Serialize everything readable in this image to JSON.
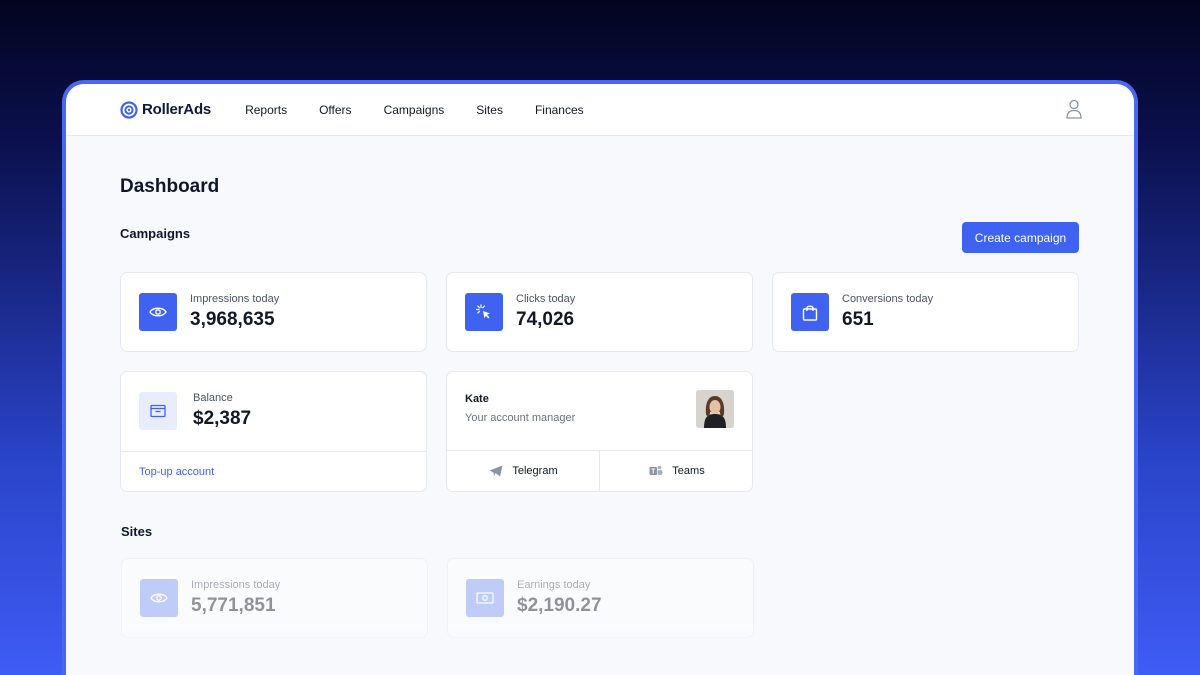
{
  "app": {
    "name": "RollerAds",
    "nav": [
      "Reports",
      "Offers",
      "Campaigns",
      "Sites",
      "Finances"
    ]
  },
  "page": {
    "title": "Dashboard"
  },
  "campaigns": {
    "title": "Campaigns",
    "create_label": "Create campaign",
    "stats": [
      {
        "label": "Impressions today",
        "value": "3,968,635",
        "icon": "eye-icon"
      },
      {
        "label": "Clicks today",
        "value": "74,026",
        "icon": "cursor-click-icon"
      },
      {
        "label": "Conversions today",
        "value": "651",
        "icon": "shopping-bag-icon"
      }
    ],
    "balance": {
      "label": "Balance",
      "value": "$2,387",
      "icon": "wallet-icon",
      "topup_label": "Top-up account"
    },
    "manager": {
      "name": "Kate",
      "role": "Your account manager",
      "contacts": [
        {
          "label": "Telegram",
          "icon": "telegram-icon"
        },
        {
          "label": "Teams",
          "icon": "teams-icon"
        }
      ]
    }
  },
  "sites": {
    "title": "Sites",
    "stats": [
      {
        "label": "Impressions today",
        "value": "5,771,851",
        "icon": "eye-icon"
      },
      {
        "label": "Earnings today",
        "value": "$2,190.27",
        "icon": "money-icon"
      }
    ]
  },
  "colors": {
    "accent": "#3f63f0",
    "frame": "#4a67f2"
  }
}
